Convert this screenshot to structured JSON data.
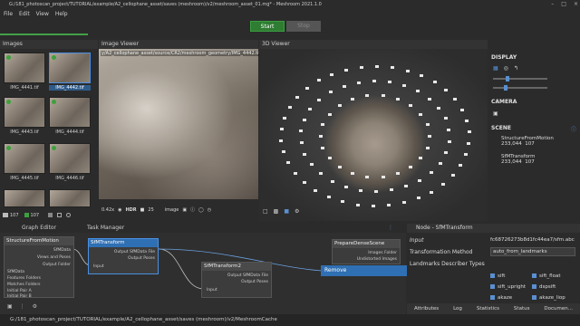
{
  "window": {
    "title": "G:/181_photoscan_project/TUTORIAL/example/A2_cellophane_asset/saves (meshroom)/v2/meshroom_asset_01.mg* - Meshroom 2021.1.0"
  },
  "menu": [
    "File",
    "Edit",
    "View",
    "Help"
  ],
  "toolbar": {
    "start": "Start",
    "stop": "Stop"
  },
  "images": {
    "title": "Images",
    "thumbs": [
      "IMG_4441.tif",
      "IMG_4442.tif",
      "IMG_4443.tif",
      "IMG_4444.tif",
      "IMG_4445.tif",
      "IMG_4446.tif"
    ],
    "count1": "107",
    "count2": "107"
  },
  "viewer": {
    "title": "Image Viewer",
    "path": "y/A2_cellophane_asset/source/CR2/meshroom_geometry/IMG_4442.tif",
    "zoom": "0.42x",
    "hdr": "HDR",
    "num": "25",
    "mode": "image"
  },
  "view3d": {
    "title": "3D Viewer"
  },
  "side": {
    "display": "DISPLAY",
    "camera": "CAMERA",
    "scene": "SCENE",
    "items": [
      {
        "name": "StructureFromMotion",
        "pts": "233,044",
        "cams": "107"
      },
      {
        "name": "SfMTransform",
        "pts": "233,044",
        "cams": "107"
      }
    ]
  },
  "graph": {
    "tab1": "Graph Editor",
    "tab2": "Task Manager",
    "nodes": {
      "sfm": {
        "title": "StructureFromMotion",
        "ports": [
          "SfMData",
          "Views and Poses",
          "Output Folder",
          "SfMData",
          "Features Folders",
          "Matches Folders",
          "Initial Pair A",
          "Initial Pair B"
        ]
      },
      "transform": {
        "title": "SfMTransform",
        "ports": [
          "Output SfMData File",
          "Output Poses",
          "Input"
        ]
      },
      "transform2": {
        "title": "SfMTransform2",
        "ports": [
          "Output SfMData File",
          "Output Poses",
          "Input"
        ]
      },
      "prepare": {
        "title": "PrepareDenseScene",
        "ports": [
          "Images Folder",
          "Undistorted Images"
        ]
      }
    },
    "context": "Remove"
  },
  "attr": {
    "title": "Node - SfMTransform",
    "rows": [
      {
        "label": "Input",
        "value": "fc68726273b8d1fc44ea7/sfm.abc"
      },
      {
        "label": "Transformation Method",
        "value": "auto_from_landmarks"
      },
      {
        "label": "Landmarks Describer Types",
        "value": ""
      }
    ],
    "checks": [
      "sift",
      "sift_float",
      "sift_upright",
      "dspsift",
      "akaze",
      "akaze_liop"
    ],
    "tabs": [
      "Attributes",
      "Log",
      "Statistics",
      "Status",
      "Documen..."
    ]
  },
  "status": "G:/181_photoscan_project/TUTORIAL/example/A2_cellophane_asset/saves (meshroom)/v2/MeshroomCache",
  "colors": {
    "accent": "#2f6fb3",
    "start": "#2e7d32",
    "progress": "#43a047"
  }
}
